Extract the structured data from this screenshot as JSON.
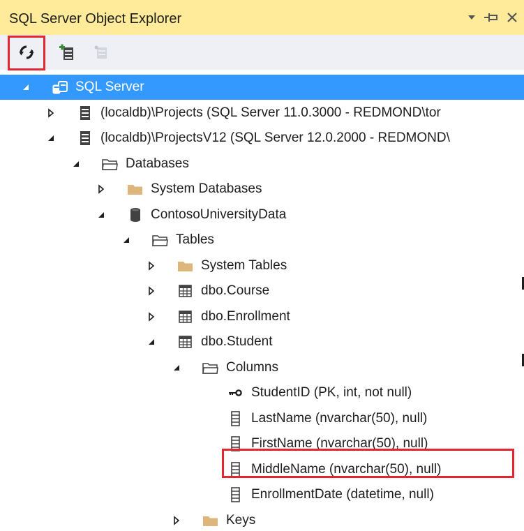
{
  "panel": {
    "title": "SQL Server Object Explorer"
  },
  "toolbar": {
    "refresh": "refresh-icon",
    "add_server": "add-server-icon",
    "stop": "stop-icon"
  },
  "tree": [
    {
      "label": "SQL Server",
      "indent": 0,
      "expander": "expanded",
      "icon": "sql-server-icon",
      "selected": true
    },
    {
      "label": "(localdb)\\Projects (SQL Server 11.0.3000 - REDMOND\\tor",
      "indent": 1,
      "expander": "collapsed",
      "icon": "server-icon"
    },
    {
      "label": "(localdb)\\ProjectsV12 (SQL Server 12.0.2000 - REDMOND\\",
      "indent": 1,
      "expander": "expanded",
      "icon": "server-icon"
    },
    {
      "label": "Databases",
      "indent": 2,
      "expander": "expanded",
      "icon": "folder-open-icon"
    },
    {
      "label": "System Databases",
      "indent": 3,
      "expander": "collapsed",
      "icon": "folder-icon"
    },
    {
      "label": "ContosoUniversityData",
      "indent": 3,
      "expander": "expanded",
      "icon": "database-icon"
    },
    {
      "label": "Tables",
      "indent": 4,
      "expander": "expanded",
      "icon": "folder-open-icon"
    },
    {
      "label": "System Tables",
      "indent": 5,
      "expander": "collapsed",
      "icon": "folder-icon"
    },
    {
      "label": "dbo.Course",
      "indent": 5,
      "expander": "collapsed",
      "icon": "table-icon"
    },
    {
      "label": "dbo.Enrollment",
      "indent": 5,
      "expander": "collapsed",
      "icon": "table-icon"
    },
    {
      "label": "dbo.Student",
      "indent": 5,
      "expander": "expanded",
      "icon": "table-icon"
    },
    {
      "label": "Columns",
      "indent": 6,
      "expander": "expanded",
      "icon": "folder-open-icon"
    },
    {
      "label": "StudentID (PK, int, not null)",
      "indent": 7,
      "expander": "none",
      "icon": "key-icon"
    },
    {
      "label": "LastName (nvarchar(50), null)",
      "indent": 7,
      "expander": "none",
      "icon": "column-icon"
    },
    {
      "label": "FirstName (nvarchar(50), null)",
      "indent": 7,
      "expander": "none",
      "icon": "column-icon"
    },
    {
      "label": "MiddleName (nvarchar(50), null)",
      "indent": 7,
      "expander": "none",
      "icon": "column-icon",
      "highlighted": true
    },
    {
      "label": "EnrollmentDate (datetime, null)",
      "indent": 7,
      "expander": "none",
      "icon": "column-icon"
    },
    {
      "label": "Keys",
      "indent": 6,
      "expander": "collapsed",
      "icon": "folder-icon"
    }
  ],
  "colors": {
    "titlebar": "#ffeb99",
    "selection": "#3399ff",
    "highlight": "#e3262f",
    "folder": "#dcb67a"
  }
}
